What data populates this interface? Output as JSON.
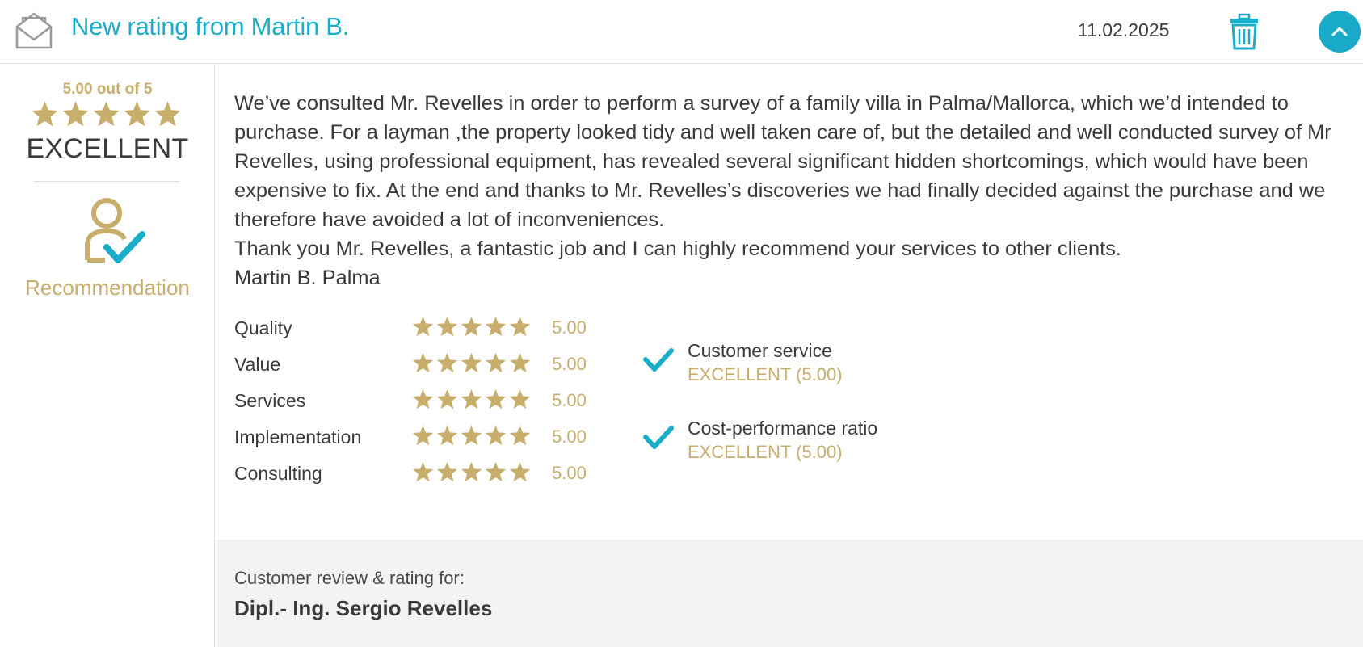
{
  "header": {
    "title": "New rating from Martin B.",
    "date": "11.02.2025",
    "icons": {
      "mail": "mail-open-icon",
      "delete": "trash-icon",
      "collapse": "chevron-up-icon"
    }
  },
  "summary": {
    "score_label": "5.00 out of 5",
    "stars": 5,
    "rating_word": "EXCELLENT",
    "recommendation_label": "Recommendation"
  },
  "review": {
    "lines": [
      "We’ve consulted Mr. Revelles in order to perform a survey of a family villa in Palma/Mallorca, which we’d intended to",
      "purchase. For a layman ,the property looked tidy and well taken care of, but the detailed and well conducted survey of Mr",
      "Revelles, using professional equipment, has revealed several significant hidden shortcomings, which would have been",
      "expensive to fix. At the end and thanks to Mr. Revelles’s discoveries we had finally decided against the purchase and we",
      "therefore have avoided a lot of inconveniences.",
      "Thank you Mr. Revelles, a fantastic job and I can highly recommend your services to other clients.",
      "Martin B. Palma"
    ]
  },
  "criteria": [
    {
      "label": "Quality",
      "stars": 5,
      "value": "5.00"
    },
    {
      "label": "Value",
      "stars": 5,
      "value": "5.00"
    },
    {
      "label": "Services",
      "stars": 5,
      "value": "5.00"
    },
    {
      "label": "Implementation",
      "stars": 5,
      "value": "5.00"
    },
    {
      "label": "Consulting",
      "stars": 5,
      "value": "5.00"
    }
  ],
  "recommendations": [
    {
      "title": "Customer service",
      "value": "EXCELLENT (5.00)"
    },
    {
      "title": "Cost-performance ratio",
      "value": "EXCELLENT (5.00)"
    }
  ],
  "footer": {
    "label": "Customer review & rating for:",
    "name": "Dipl.- Ing. Sergio Revelles"
  },
  "colors": {
    "accent": "#1aaec9",
    "gold": "#c8ae6c",
    "text": "#3a3a3a",
    "footer_bg": "#f2f3f4"
  }
}
